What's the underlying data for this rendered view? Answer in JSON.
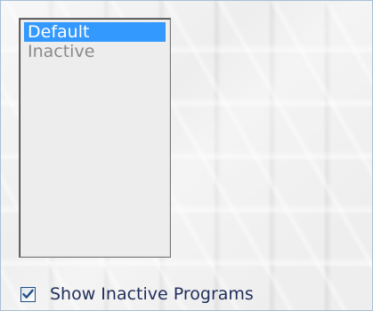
{
  "program_list": {
    "items": [
      {
        "label": "Default",
        "selected": true,
        "state": "active"
      },
      {
        "label": "Inactive",
        "selected": false,
        "state": "inactive"
      }
    ]
  },
  "options": {
    "show_inactive_label": "Show Inactive Programs",
    "show_inactive_checked": true
  },
  "icons": {
    "checkbox_mark": "check-icon"
  },
  "colors": {
    "selection": "#3399ff",
    "inactive_text": "#8a8a8a",
    "label_text": "#1f2e5a",
    "checkmark": "#1f4f86"
  }
}
